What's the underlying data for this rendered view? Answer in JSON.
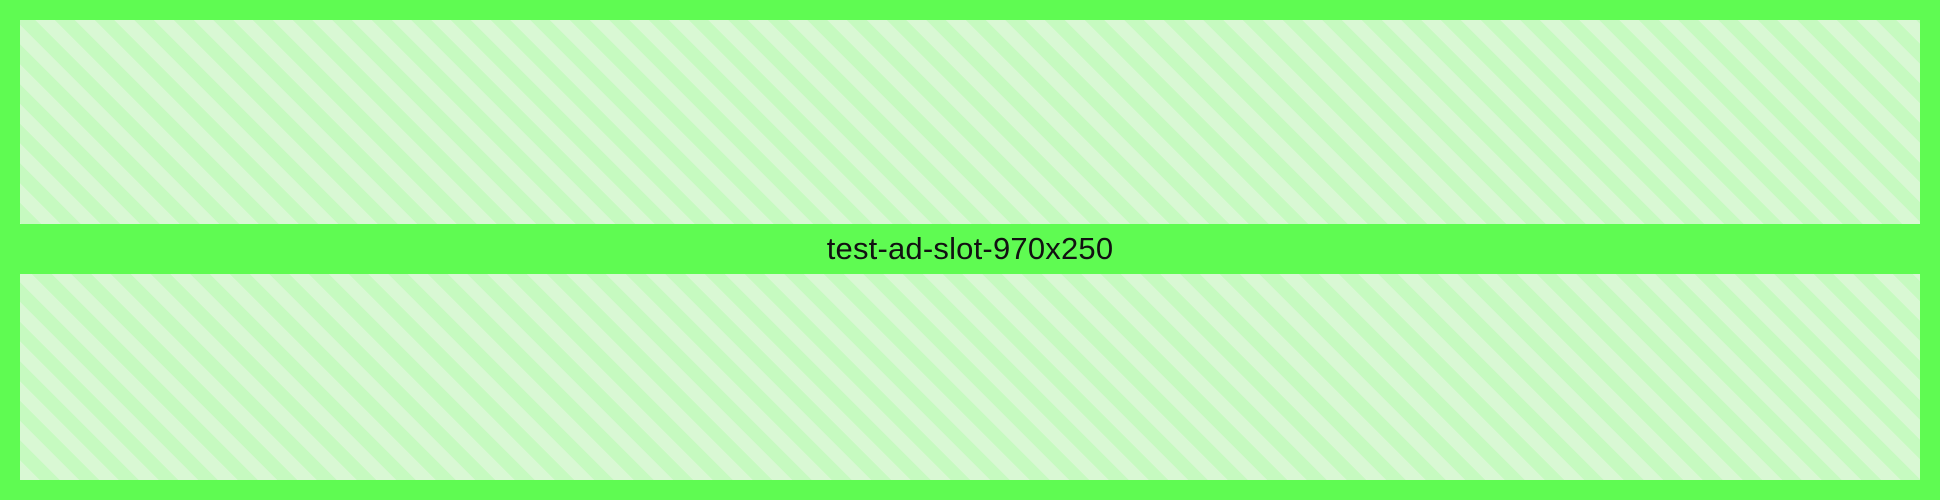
{
  "ad": {
    "label": "test-ad-slot-970x250",
    "colors": {
      "border": "#5ffb52",
      "stripe_light": "#d9f8d4",
      "stripe_dark": "#c6fac0",
      "label_bar": "#5ffb52",
      "bar_edge": "#2ff82a",
      "text": "#111111"
    }
  }
}
